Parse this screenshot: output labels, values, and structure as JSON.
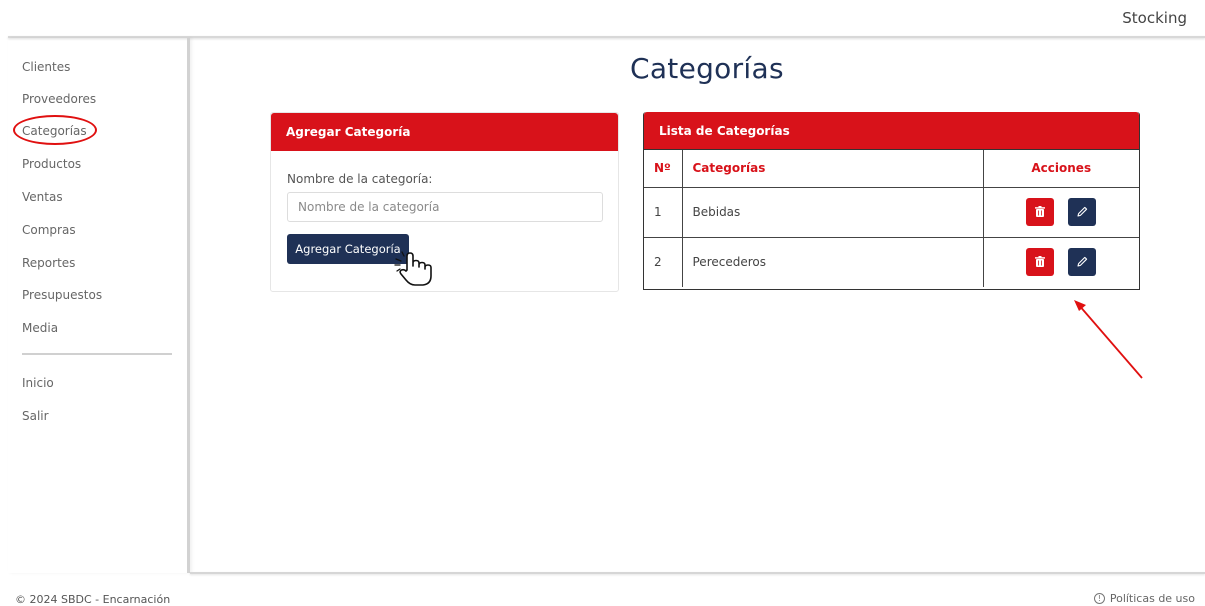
{
  "app": {
    "brand": "Stocking"
  },
  "sidebar": {
    "items": [
      {
        "label": "Clientes"
      },
      {
        "label": "Proveedores"
      },
      {
        "label": "Categorías"
      },
      {
        "label": "Productos"
      },
      {
        "label": "Ventas"
      },
      {
        "label": "Compras"
      },
      {
        "label": "Reportes"
      },
      {
        "label": "Presupuestos"
      },
      {
        "label": "Media"
      }
    ],
    "bottom_items": [
      {
        "label": "Inicio"
      },
      {
        "label": "Salir"
      }
    ],
    "active": "Categorías"
  },
  "page": {
    "title": "Categorías"
  },
  "add_form": {
    "header": "Agregar Categoría",
    "field_label": "Nombre de la categoría:",
    "placeholder": "Nombre de la categoría",
    "value": "",
    "button_label": "Agregar Categoría"
  },
  "category_list": {
    "header": "Lista de Categorías",
    "columns": [
      "Nº",
      "Categorías",
      "Acciones"
    ],
    "rows": [
      {
        "num": "1",
        "name": "Bebidas"
      },
      {
        "num": "2",
        "name": "Perecederos"
      }
    ],
    "actions": [
      "trash-icon",
      "pencil-icon"
    ]
  },
  "footer": {
    "copyright": "© 2024 SBDC - Encarnación",
    "policy": "Políticas de uso"
  },
  "colors": {
    "primary_red": "#d8121a",
    "navy": "#1f3156",
    "annotation_red": "#e01010"
  }
}
